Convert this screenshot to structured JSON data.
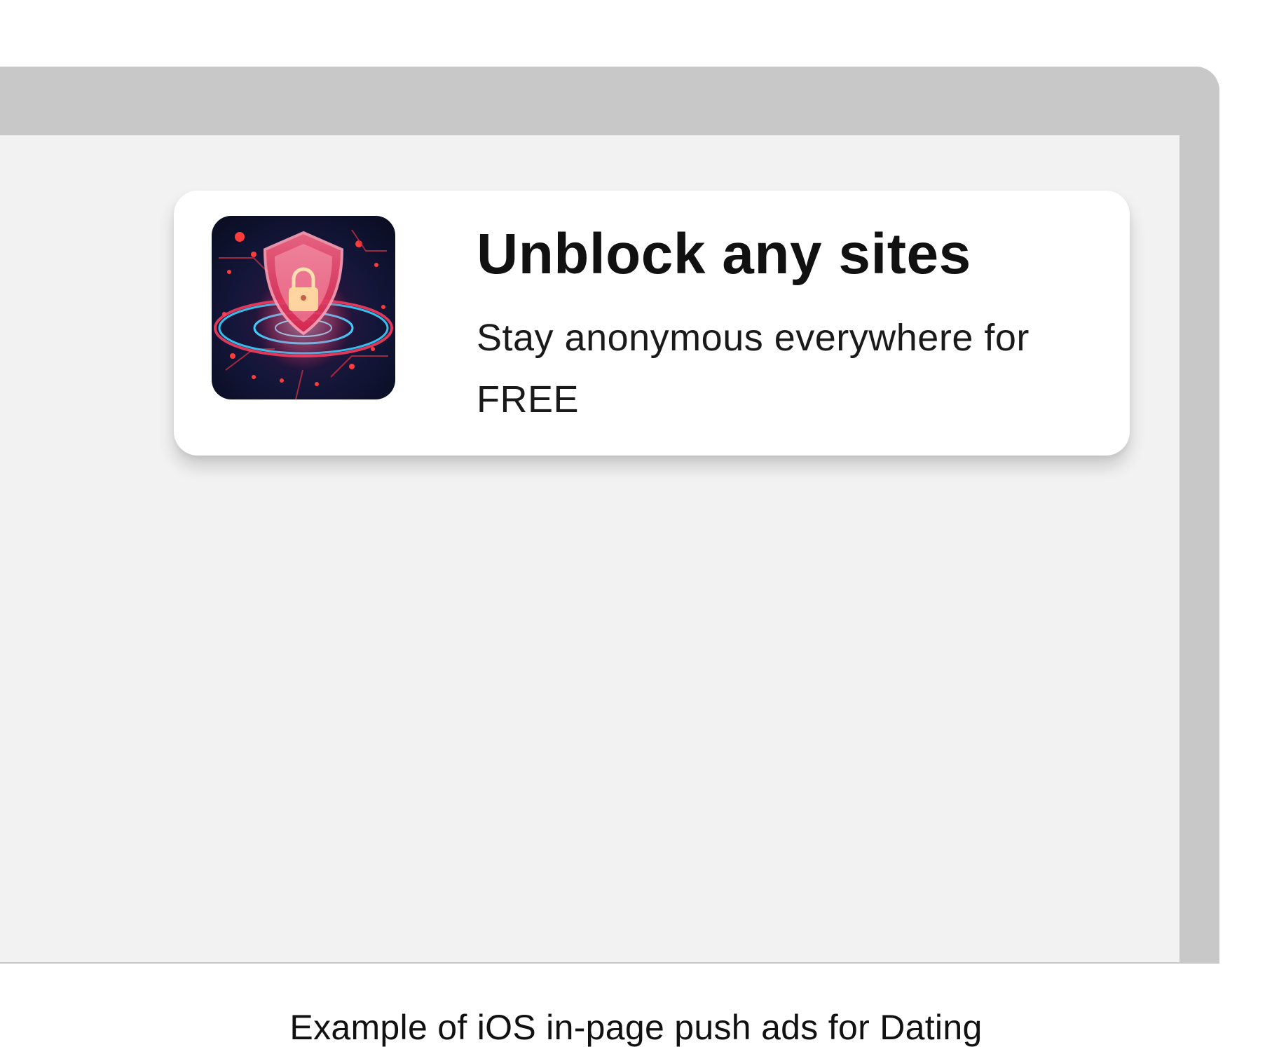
{
  "notification": {
    "title": "Unblock any sites",
    "body": "Stay anonymous everywhere for FREE",
    "icon": "shield-lock-icon"
  },
  "caption": "Example of iOS in-page push ads for Dating",
  "colors": {
    "frame": "#c8c8c8",
    "screen": "#f2f2f2",
    "card": "#ffffff",
    "text": "#111111"
  }
}
